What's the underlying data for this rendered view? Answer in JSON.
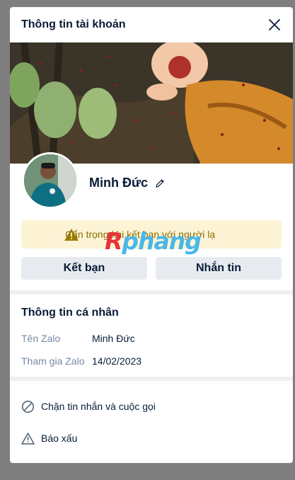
{
  "header": {
    "title": "Thông tin tài khoản",
    "close_icon": "close-icon"
  },
  "profile": {
    "name": "Minh Đức",
    "edit_icon": "pencil-icon"
  },
  "warning": {
    "text": "Cẩn trọng khi kết bạn với người lạ",
    "icon": "warning-icon"
  },
  "watermark": {
    "part1": "R",
    "part2": "phang"
  },
  "actions": {
    "add_friend": "Kết bạn",
    "message": "Nhắn tin"
  },
  "personal_info": {
    "title": "Thông tin cá nhân",
    "rows": [
      {
        "label": "Tên Zalo",
        "value": "Minh Đức"
      },
      {
        "label": "Tham gia Zalo",
        "value": "14/02/2023"
      }
    ]
  },
  "options": [
    {
      "label": "Chặn tin nhắn và cuộc gọi",
      "icon": "block-icon"
    },
    {
      "label": "Báo xấu",
      "icon": "report-icon"
    }
  ],
  "colors": {
    "text": "#081c36",
    "muted": "#7589a3",
    "warning_bg": "#fdf4d6",
    "button_bg": "#e7ebf0"
  }
}
